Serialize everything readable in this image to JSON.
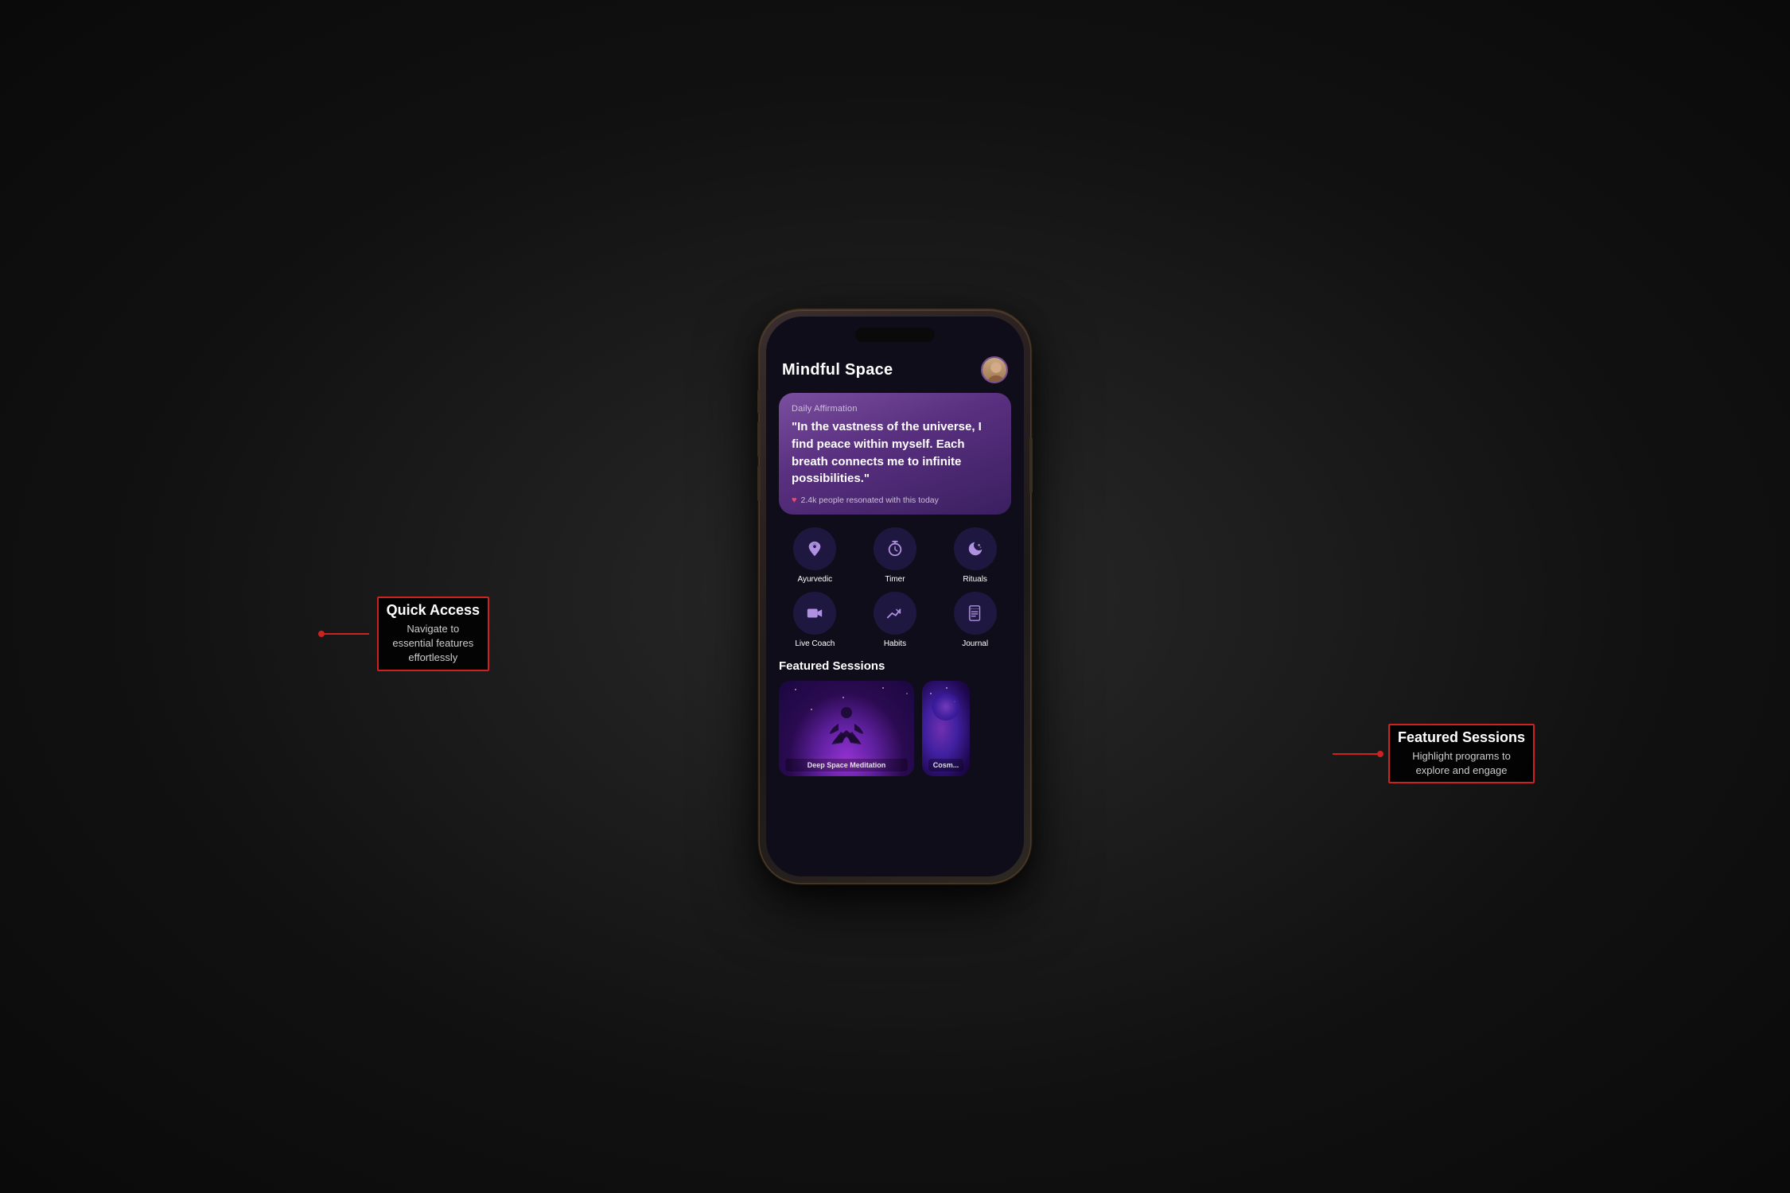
{
  "app": {
    "title": "Mindful Space",
    "header": {
      "title": "Mindful Space",
      "avatar_alt": "User avatar"
    }
  },
  "affirmation": {
    "label": "Daily Affirmation",
    "text": "\"In the vastness of the universe, I find peace within myself. Each breath connects me to infinite possibilities.\"",
    "resonance_count": "2.4k",
    "resonance_text": "2.4k people resonated with this today"
  },
  "quick_access": {
    "section_title": "Quick Access",
    "annotation_title": "Quick Access",
    "annotation_desc": "Navigate to\nessential features\neffortlessly",
    "items": [
      {
        "id": "ayurvedic",
        "label": "Ayurvedic",
        "icon": "leaf"
      },
      {
        "id": "timer",
        "label": "Timer",
        "icon": "clock"
      },
      {
        "id": "rituals",
        "label": "Rituals",
        "icon": "moon"
      },
      {
        "id": "live-coach",
        "label": "Live Coach",
        "icon": "video"
      },
      {
        "id": "habits",
        "label": "Habits",
        "icon": "chart"
      },
      {
        "id": "journal",
        "label": "Journal",
        "icon": "book"
      }
    ]
  },
  "featured_sessions": {
    "section_title": "Featured Sessions",
    "annotation_title": "Featured Sessions",
    "annotation_desc": "Highlight programs to\nexplore and engage",
    "cards": [
      {
        "id": "deep-space",
        "label": "Deep Space Meditation",
        "type": "meditation"
      },
      {
        "id": "cosmic",
        "label": "Cosm...",
        "type": "cosmic"
      }
    ]
  }
}
